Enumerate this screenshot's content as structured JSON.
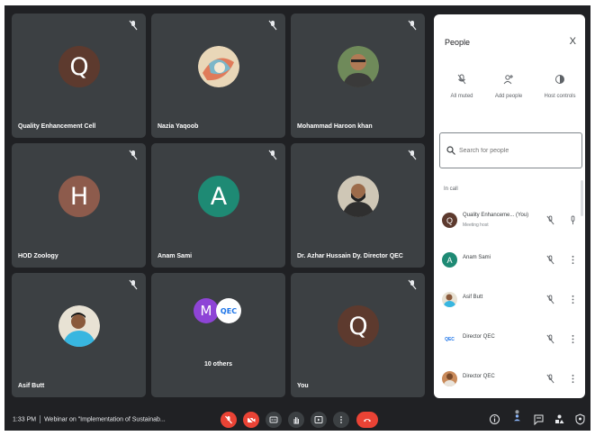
{
  "tiles": [
    {
      "name": "Quality Enhancement Cell",
      "initial": "Q",
      "color": "#5d3a2e"
    },
    {
      "name": "Nazia Yaqoob",
      "initial": "",
      "color": ""
    },
    {
      "name": "Mohammad Haroon khan",
      "initial": "",
      "color": ""
    },
    {
      "name": "HOD Zoology",
      "initial": "H",
      "color": "#8d5b4c"
    },
    {
      "name": "Anam Sami",
      "initial": "A",
      "color": "#1e8a74"
    },
    {
      "name": "Dr. Azhar Hussain Dy. Director QEC",
      "initial": "",
      "color": ""
    },
    {
      "name": "Asif Butt",
      "initial": "",
      "color": ""
    },
    {
      "name": "10 others",
      "initial": "M",
      "color": "#8e44d6"
    },
    {
      "name": "You",
      "initial": "Q",
      "color": "#5d3a2e"
    }
  ],
  "others_logo_text": "QEC",
  "bottombar": {
    "time": "1:33 PM",
    "meeting_title": "Webinar on \"Implementation of Sustainab..."
  },
  "panel": {
    "title": "People",
    "close": "X",
    "actions": [
      "All muted",
      "Add people",
      "Host controls"
    ],
    "search_placeholder": "Search for people",
    "section_label": "In call",
    "people": [
      {
        "name": "Quality Enhanceme... (You)",
        "sub": "Meeting host",
        "initial": "Q",
        "color": "#5d3a2e"
      },
      {
        "name": "Anam Sami",
        "sub": "",
        "initial": "A",
        "color": "#1e8a74"
      },
      {
        "name": "Asif Butt",
        "sub": "",
        "initial": "",
        "color": "#2b4a6e"
      },
      {
        "name": "Director QEC",
        "sub": "",
        "initial": "QEC",
        "color": "#ffffff"
      },
      {
        "name": "Director QEC",
        "sub": "",
        "initial": "",
        "color": "#c98a5a"
      }
    ]
  },
  "colors": {
    "background": "#202124",
    "tile": "#3c4043",
    "danger": "#ea4335"
  }
}
